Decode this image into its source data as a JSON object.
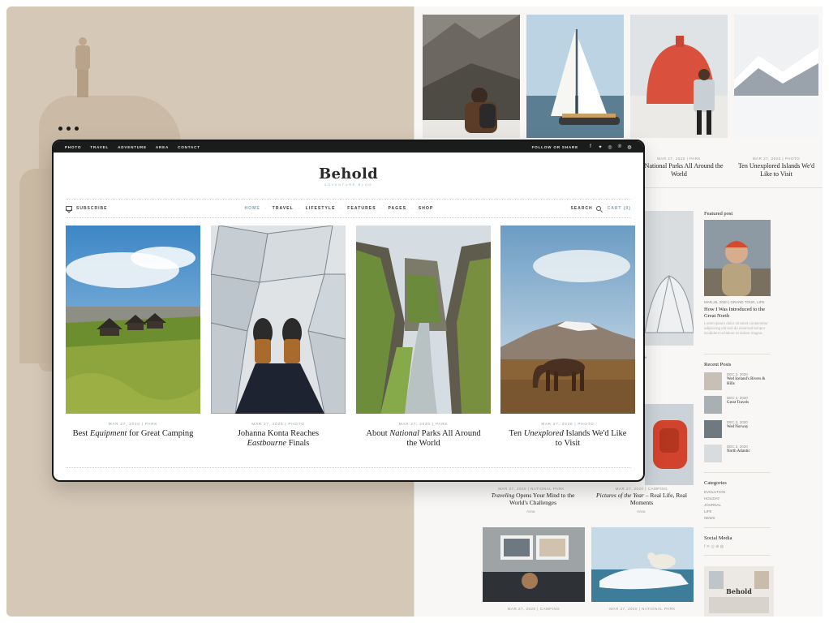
{
  "left_bg": {
    "color": "#d6c8b6"
  },
  "back_page": {
    "top_captions": [
      {
        "text": "out National Parks All Around the World"
      },
      {
        "text": "Ten Unexplored Islands We'd Like to Visit"
      }
    ],
    "top_meta": [
      "MAR 27, 2020 | PARK",
      "MAR 27, 2020 | PHOTO"
    ],
    "sidebar": {
      "featured_heading": "Featured post",
      "featured_meta": "MAR 26, 2020 | GRAND TOUR, LIFE",
      "featured_title": "How I Was Introduced to the Great North",
      "featured_excerpt": "Lorem ipsum dolor sit amet consectetur adipiscing elit sed do eiusmod tempor incididunt ut labore et dolore magna",
      "recent_heading": "Recent Posts",
      "recent": [
        {
          "date": "DEC 2, 2020",
          "title": "Wed Iceland's Rivers & Hills"
        },
        {
          "date": "DEC 2, 2020",
          "title": "Great Travels"
        },
        {
          "date": "DEC 2, 2020",
          "title": "Wed Norway"
        },
        {
          "date": "DEC 2, 2020",
          "title": "North Atlantic"
        }
      ],
      "categories_heading": "Categories",
      "categories": [
        "EVOLUTION",
        "HOLIDAY",
        "JOURNAL",
        "LIFE",
        "NEWS"
      ],
      "social_heading": "Social Media",
      "social_icons": "f ✕ ◎ ⊕ ◍",
      "mini_logo": "Behold"
    },
    "mid_posts": [
      {
        "meta": "MAR 27, 2020 | NATIONAL PARK",
        "title_a": "Traveling",
        "title_b": " Opens Your Mind to the World's Challenges",
        "author": "Anna"
      },
      {
        "meta": "MAR 27, 2020 | CAMPING",
        "title_a": "Pictures of the Year",
        "title_b": " – Real Life, Real Moments",
        "author": "Anna"
      }
    ],
    "bottom_meta": [
      "MAR 27, 2020 | CAMPING",
      "MAR 27, 2020 | NATIONAL PARK"
    ],
    "side_cutoff": "e"
  },
  "window": {
    "topbar": {
      "links": [
        "PHOTO",
        "TRAVEL",
        "ADVENTURE",
        "AREA",
        "CONTACT"
      ],
      "follow": "FOLLOW OR SHARE",
      "social": [
        "f",
        "✦",
        "◎",
        "℗",
        "◍"
      ]
    },
    "logo": "Behold",
    "tagline": "ADVENTURE BLOG",
    "nav": {
      "subscribe": "SUBSCRIBE",
      "items": [
        "HOME",
        "TRAVEL",
        "LIFESTYLE",
        "FEATURES",
        "PAGES",
        "SHOP"
      ],
      "search": "SEARCH",
      "cart": "CART (0)"
    },
    "posts": [
      {
        "meta": "MAR 27, 2020 | PARK",
        "t1": "Best ",
        "t2": "Equipment",
        "t3": " for Great Camping"
      },
      {
        "meta": "MAR 27, 2020 | PHOTO",
        "t1": "Johanna Konta Reaches ",
        "t2": "Eastbourne",
        "t3": " Finals"
      },
      {
        "meta": "MAR 27, 2020 | PARK",
        "t1": "About ",
        "t2": "National",
        "t3": " Parks All Around the World"
      },
      {
        "meta": "MAR 27, 2020 | PHOTO",
        "t1": "Ten ",
        "t2": "Unexplored",
        "t3": " Islands We'd Like to Visit"
      }
    ]
  }
}
